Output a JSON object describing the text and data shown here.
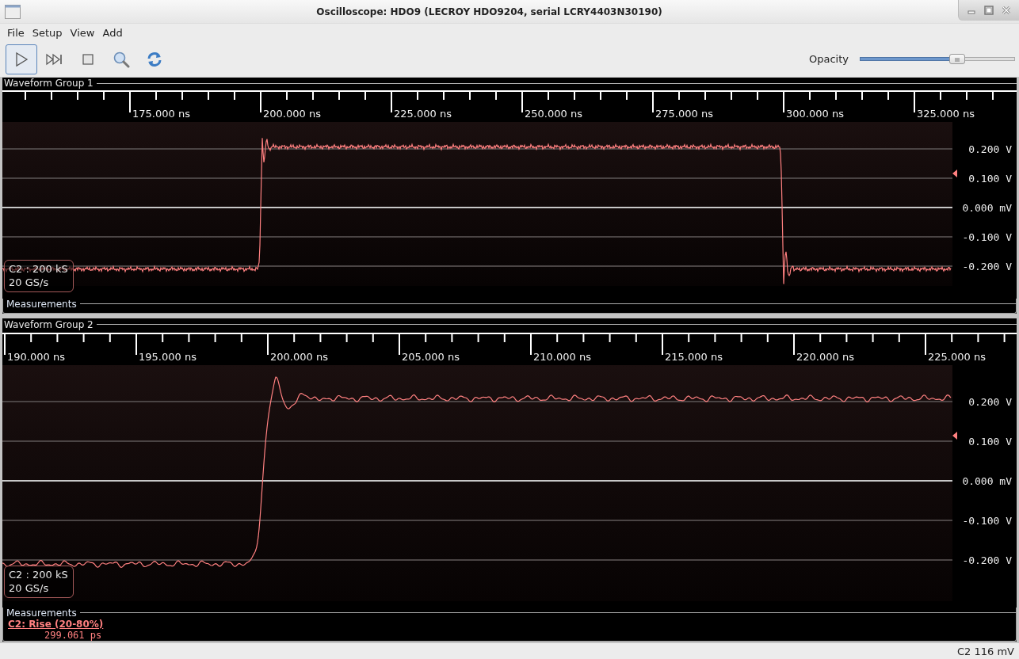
{
  "window": {
    "title": "Oscilloscope: HDO9 (LECROY HDO9204, serial LCRY4403N30190)"
  },
  "menu": [
    "File",
    "Setup",
    "View",
    "Add"
  ],
  "toolbar": {
    "buttons": [
      {
        "kind": "play",
        "selected": true
      },
      {
        "kind": "step",
        "selected": false
      },
      {
        "kind": "stop",
        "selected": false
      },
      {
        "kind": "zoom",
        "selected": false
      },
      {
        "kind": "refresh",
        "selected": false
      }
    ],
    "opacity": {
      "label": "Opacity",
      "level": 0.63
    }
  },
  "groups": [
    {
      "title": "Waveform Group 1",
      "kind": "pulse",
      "time_labels": [
        "175.000 ns",
        "200.000 ns",
        "225.000 ns",
        "250.000 ns",
        "275.000 ns",
        "300.000 ns",
        "325.000 ns"
      ],
      "volt_labels": [
        "0.200 V",
        "0.100 V",
        "0.000 mV",
        "-0.100 V",
        "-0.200 V"
      ],
      "channel": {
        "samples": "C2 : 200 kS",
        "rate": "20 GS/s",
        "color": "#ff8080"
      },
      "measurements": {
        "title": "Measurements"
      }
    },
    {
      "title": "Waveform Group 2",
      "kind": "step",
      "time_labels": [
        "190.000 ns",
        "195.000 ns",
        "200.000 ns",
        "205.000 ns",
        "210.000 ns",
        "215.000 ns",
        "220.000 ns",
        "225.000 ns"
      ],
      "volt_labels": [
        "0.200 V",
        "0.100 V",
        "0.000 mV",
        "-0.100 V",
        "-0.200 V"
      ],
      "channel": {
        "samples": "C2 : 200 kS",
        "rate": "20 GS/s",
        "color": "#ff8080"
      },
      "measurements": {
        "title": "Measurements",
        "items": [
          {
            "name": "C2: Rise (20-80%)",
            "value": "299.061 ps"
          }
        ]
      }
    }
  ],
  "status_bar": "C2 116 mV"
}
